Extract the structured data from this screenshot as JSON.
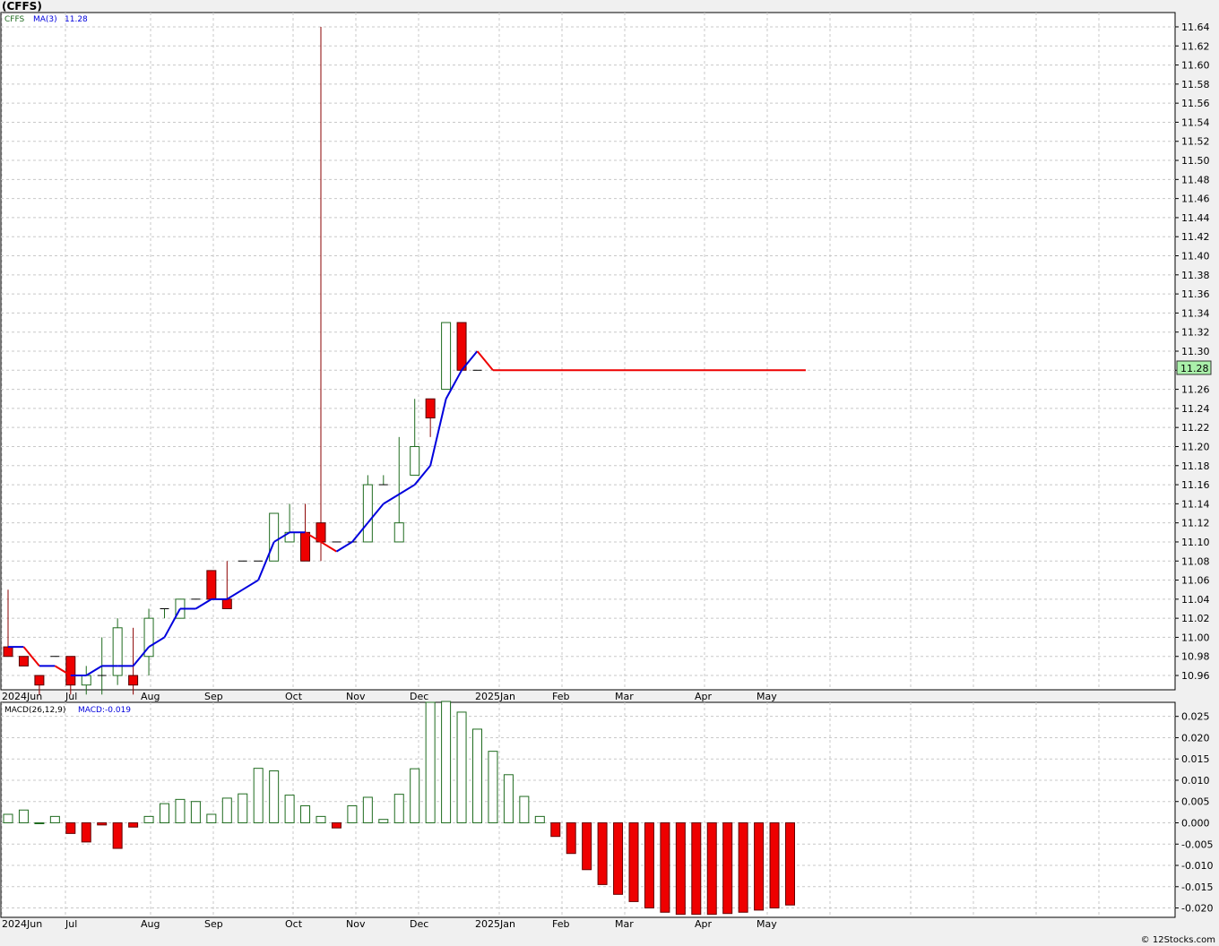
{
  "title": "(CFFS)",
  "watermark": "© 12Stocks.com",
  "colors": {
    "up": "#1f6b1f",
    "down_fill": "#ee0000",
    "ma_up": "#0000dd",
    "ma_down": "#ee0000",
    "grid": "#c8c8c8",
    "bg": "#ffffff",
    "frame_bg": "#f0f0f0",
    "last_price_bg": "#aaf0aa",
    "wick_down": "#8b0000"
  },
  "chart_data": [
    {
      "type": "candlestick",
      "legend": {
        "symbol": "CFFS",
        "ma_label": "MA(3)",
        "ma_value": "11.28"
      },
      "last_price_label": "11.28",
      "ylim": [
        10.945,
        11.655
      ],
      "y_ticks": [
        "10.96",
        "10.98",
        "11.00",
        "11.02",
        "11.04",
        "11.06",
        "11.08",
        "11.10",
        "11.12",
        "11.14",
        "11.16",
        "11.18",
        "11.20",
        "11.22",
        "11.24",
        "11.26",
        "11.28",
        "11.30",
        "11.32",
        "11.34",
        "11.36",
        "11.38",
        "11.40",
        "11.42",
        "11.44",
        "11.46",
        "11.48",
        "11.50",
        "11.52",
        "11.54",
        "11.56",
        "11.58",
        "11.60",
        "11.62",
        "11.64"
      ],
      "x_labels": [
        "2024Jun",
        "Jul",
        "Aug",
        "Sep",
        "Oct",
        "Nov",
        "Dec",
        "2025Jan",
        "Feb",
        "Mar",
        "Apr",
        "May"
      ],
      "candles": [
        {
          "o": 10.99,
          "h": 11.05,
          "l": 10.98,
          "c": 10.98
        },
        {
          "o": 10.98,
          "h": 10.98,
          "l": 10.97,
          "c": 10.97
        },
        {
          "o": 10.96,
          "h": 10.96,
          "l": 10.94,
          "c": 10.95
        },
        {
          "o": 10.98,
          "h": 10.98,
          "l": 10.98,
          "c": 10.98
        },
        {
          "o": 10.98,
          "h": 10.98,
          "l": 10.94,
          "c": 10.95
        },
        {
          "o": 10.95,
          "h": 10.97,
          "l": 10.94,
          "c": 10.96
        },
        {
          "o": 10.96,
          "h": 11.0,
          "l": 10.94,
          "c": 10.96
        },
        {
          "o": 10.96,
          "h": 11.02,
          "l": 10.95,
          "c": 11.01
        },
        {
          "o": 10.96,
          "h": 11.01,
          "l": 10.94,
          "c": 10.95
        },
        {
          "o": 10.98,
          "h": 11.03,
          "l": 10.96,
          "c": 11.02
        },
        {
          "o": 11.03,
          "h": 11.03,
          "l": 11.02,
          "c": 11.03
        },
        {
          "o": 11.02,
          "h": 11.04,
          "l": 11.02,
          "c": 11.04
        },
        {
          "o": 11.04,
          "h": 11.04,
          "l": 11.04,
          "c": 11.04
        },
        {
          "o": 11.07,
          "h": 11.07,
          "l": 11.04,
          "c": 11.04
        },
        {
          "o": 11.04,
          "h": 11.08,
          "l": 11.03,
          "c": 11.03
        },
        {
          "o": 11.08,
          "h": 11.08,
          "l": 11.08,
          "c": 11.08
        },
        {
          "o": 11.08,
          "h": 11.08,
          "l": 11.08,
          "c": 11.08
        },
        {
          "o": 11.08,
          "h": 11.13,
          "l": 11.08,
          "c": 11.13
        },
        {
          "o": 11.1,
          "h": 11.14,
          "l": 11.1,
          "c": 11.11
        },
        {
          "o": 11.11,
          "h": 11.14,
          "l": 11.08,
          "c": 11.08
        },
        {
          "o": 11.12,
          "h": 11.64,
          "l": 11.08,
          "c": 11.1
        },
        {
          "o": 11.1,
          "h": 11.1,
          "l": 11.1,
          "c": 11.1
        },
        {
          "o": 11.1,
          "h": 11.1,
          "l": 11.1,
          "c": 11.1
        },
        {
          "o": 11.1,
          "h": 11.17,
          "l": 11.1,
          "c": 11.16
        },
        {
          "o": 11.16,
          "h": 11.17,
          "l": 11.16,
          "c": 11.16
        },
        {
          "o": 11.1,
          "h": 11.21,
          "l": 11.1,
          "c": 11.12
        },
        {
          "o": 11.17,
          "h": 11.25,
          "l": 11.17,
          "c": 11.2
        },
        {
          "o": 11.25,
          "h": 11.25,
          "l": 11.21,
          "c": 11.23
        },
        {
          "o": 11.26,
          "h": 11.33,
          "l": 11.26,
          "c": 11.33
        },
        {
          "o": 11.33,
          "h": 11.33,
          "l": 11.28,
          "c": 11.28
        },
        {
          "o": 11.28,
          "h": 11.28,
          "l": 11.28,
          "c": 11.28
        }
      ],
      "ma3": [
        10.99,
        10.99,
        10.97,
        10.97,
        10.96,
        10.96,
        10.97,
        10.97,
        10.97,
        10.99,
        11.0,
        11.03,
        11.03,
        11.04,
        11.04,
        11.05,
        11.06,
        11.1,
        11.11,
        11.11,
        11.1,
        11.09,
        11.1,
        11.12,
        11.14,
        11.15,
        11.16,
        11.18,
        11.25,
        11.28,
        11.3,
        11.28
      ],
      "ma_flat_value": 11.28,
      "ma_flat_end_index": 51
    },
    {
      "type": "bar",
      "legend": {
        "label1": "MACD(26,12,9)",
        "label2": "MACD:-0.019"
      },
      "ylim": [
        -0.0222,
        0.0283
      ],
      "y_ticks": [
        "-0.020",
        "-0.015",
        "-0.010",
        "-0.005",
        "0.000",
        "0.005",
        "0.010",
        "0.015",
        "0.020",
        "0.025"
      ],
      "x_labels": [
        "2024Jun",
        "Jul",
        "Aug",
        "Sep",
        "Oct",
        "Nov",
        "Dec",
        "2025Jan",
        "Feb",
        "Mar",
        "Apr",
        "May"
      ],
      "values": [
        0.002,
        0.003,
        0.0,
        0.0015,
        -0.0025,
        -0.0045,
        -0.0005,
        -0.006,
        -0.001,
        0.0015,
        0.0045,
        0.0055,
        0.005,
        0.002,
        0.0058,
        0.0068,
        0.0128,
        0.0122,
        0.0065,
        0.004,
        0.0015,
        -0.0012,
        0.004,
        0.006,
        0.0008,
        0.0067,
        0.0127,
        0.0283,
        0.0285,
        0.026,
        0.022,
        0.0168,
        0.0113,
        0.0062,
        0.0015,
        -0.0032,
        -0.0072,
        -0.011,
        -0.0145,
        -0.0168,
        -0.0185,
        -0.02,
        -0.021,
        -0.0215,
        -0.0215,
        -0.0215,
        -0.0213,
        -0.021,
        -0.0205,
        -0.02,
        -0.0193
      ]
    }
  ]
}
